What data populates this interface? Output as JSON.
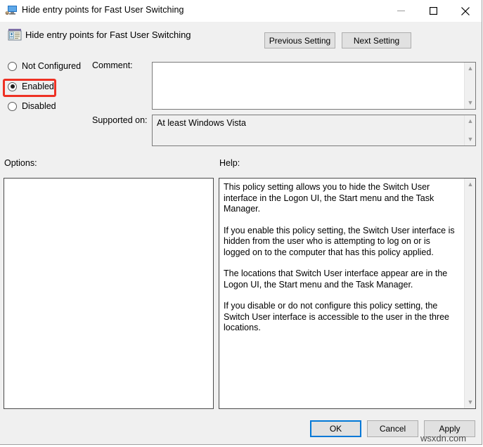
{
  "window": {
    "title": "Hide entry points for Fast User Switching",
    "title_icon": "computer-monitor-icon",
    "controls": {
      "minimize": "minimize-icon",
      "maximize": "maximize-icon",
      "close": "close-icon"
    }
  },
  "header": {
    "policy_icon": "group-policy-setting-icon",
    "policy_title": "Hide entry points for Fast User Switching",
    "previous_setting_label": "Previous Setting",
    "next_setting_label": "Next Setting"
  },
  "state_options": {
    "selected": "Enabled",
    "items": [
      {
        "label": "Not Configured",
        "checked": false
      },
      {
        "label": "Enabled",
        "checked": true
      },
      {
        "label": "Disabled",
        "checked": false
      }
    ],
    "highlight_color": "#ee3124"
  },
  "comment": {
    "label": "Comment:",
    "value": "",
    "placeholder": ""
  },
  "supported_on": {
    "label": "Supported on:",
    "value": "At least Windows Vista"
  },
  "options": {
    "label": "Options:",
    "value": ""
  },
  "help": {
    "label": "Help:",
    "paragraphs": [
      "This policy setting allows you to hide the Switch User interface in the Logon UI, the Start menu and the Task Manager.",
      "If you enable this policy setting, the Switch User interface is hidden from the user who is attempting to log on or is logged on to the computer that has this policy applied.",
      "The locations that Switch User interface appear are in the Logon UI, the Start menu and the Task Manager.",
      "If you disable or do not configure this policy setting, the Switch User interface is accessible to the user in the three locations."
    ]
  },
  "buttons": {
    "ok": "OK",
    "cancel": "Cancel",
    "apply": "Apply",
    "focus_color": "#0078d7"
  },
  "watermark": "wsxdn.com"
}
